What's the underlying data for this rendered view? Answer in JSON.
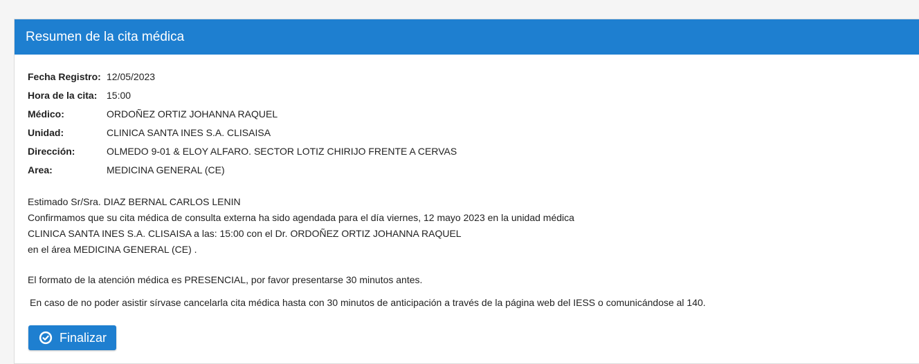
{
  "panel": {
    "title": "Resumen de la cita médica"
  },
  "details": [
    {
      "label": "Fecha Registro:",
      "value": "12/05/2023"
    },
    {
      "label": "Hora de la cita:",
      "value": "15:00"
    },
    {
      "label": "Médico:",
      "value": "ORDOÑEZ ORTIZ JOHANNA RAQUEL"
    },
    {
      "label": "Unidad:",
      "value": "CLINICA SANTA INES S.A. CLISAISA"
    },
    {
      "label": "Dirección:",
      "value": "OLMEDO 9-01 & ELOY ALFARO. SECTOR LOTIZ CHIRIJO FRENTE A CERVAS"
    },
    {
      "label": "Area:",
      "value": "MEDICINA GENERAL (CE)"
    }
  ],
  "message": {
    "greeting": "Estimado Sr/Sra. DIAZ BERNAL CARLOS LENIN",
    "line1": "Confirmamos que su cita médica de consulta externa ha sido agendada para el día viernes, 12 mayo 2023 en la unidad médica",
    "line2": "CLINICA SANTA INES S.A. CLISAISA a las: 15:00 con el Dr. ORDOÑEZ ORTIZ JOHANNA RAQUEL",
    "line3": "en el área MEDICINA GENERAL (CE) .",
    "format": "El formato de la atención médica es PRESENCIAL, por favor presentarse 30 minutos antes.",
    "cancel_notice": "En caso de no poder asistir sírvase cancelarla cita médica hasta con 30 minutos de anticipación a través de la página web del IESS o comunicándose al 140."
  },
  "actions": {
    "finish_label": "Finalizar",
    "finish_icon": "check-circle-icon"
  },
  "colors": {
    "header": "#1e7fd0",
    "button": "#1e7fd0"
  }
}
